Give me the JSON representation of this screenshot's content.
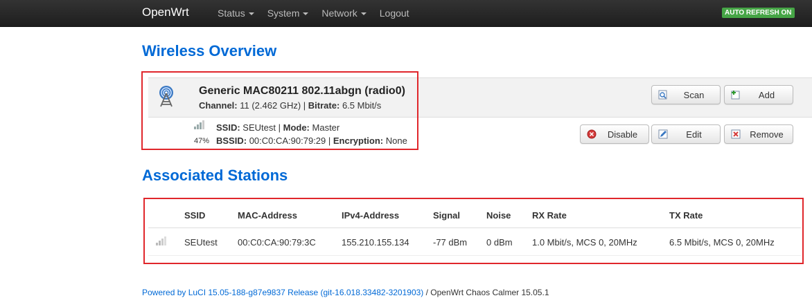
{
  "navbar": {
    "brand": "OpenWrt",
    "menu": [
      {
        "label": "Status",
        "dropdown": true
      },
      {
        "label": "System",
        "dropdown": true
      },
      {
        "label": "Network",
        "dropdown": true
      },
      {
        "label": "Logout",
        "dropdown": false
      }
    ],
    "auto_refresh": "AUTO REFRESH ON"
  },
  "wireless": {
    "heading": "Wireless Overview",
    "radio": {
      "name": "Generic MAC80211 802.11abgn (radio0)",
      "channel_label": "Channel:",
      "channel_value": "11 (2.462 GHz)",
      "bitrate_label": "Bitrate:",
      "bitrate_value": "6.5 Mbit/s",
      "scan_label": "Scan",
      "add_label": "Add"
    },
    "network": {
      "signal_percent": "47%",
      "ssid_label": "SSID:",
      "ssid_value": "SEUtest",
      "mode_label": "Mode:",
      "mode_value": "Master",
      "bssid_label": "BSSID:",
      "bssid_value": "00:C0:CA:90:79:29",
      "encryption_label": "Encryption:",
      "encryption_value": "None",
      "disable_label": "Disable",
      "edit_label": "Edit",
      "remove_label": "Remove"
    }
  },
  "stations": {
    "heading": "Associated Stations",
    "columns": [
      "SSID",
      "MAC-Address",
      "IPv4-Address",
      "Signal",
      "Noise",
      "RX Rate",
      "TX Rate"
    ],
    "rows": [
      {
        "ssid": "SEUtest",
        "mac": "00:C0:CA:90:79:3C",
        "ipv4": "155.210.155.134",
        "signal": "-77 dBm",
        "noise": "0 dBm",
        "rx_rate": "1.0 Mbit/s, MCS 0, 20MHz",
        "tx_rate": "6.5 Mbit/s, MCS 0, 20MHz"
      }
    ]
  },
  "footer": {
    "link": "Powered by LuCI 15.05-188-g87e9837 Release (git-16.018.33482-3201903)",
    "text": " / OpenWrt Chaos Calmer 15.05.1"
  },
  "colors": {
    "accent": "#0069d6",
    "navbar": "#222222",
    "highlight": "#e0262b",
    "refresh_badge": "#46a546"
  }
}
